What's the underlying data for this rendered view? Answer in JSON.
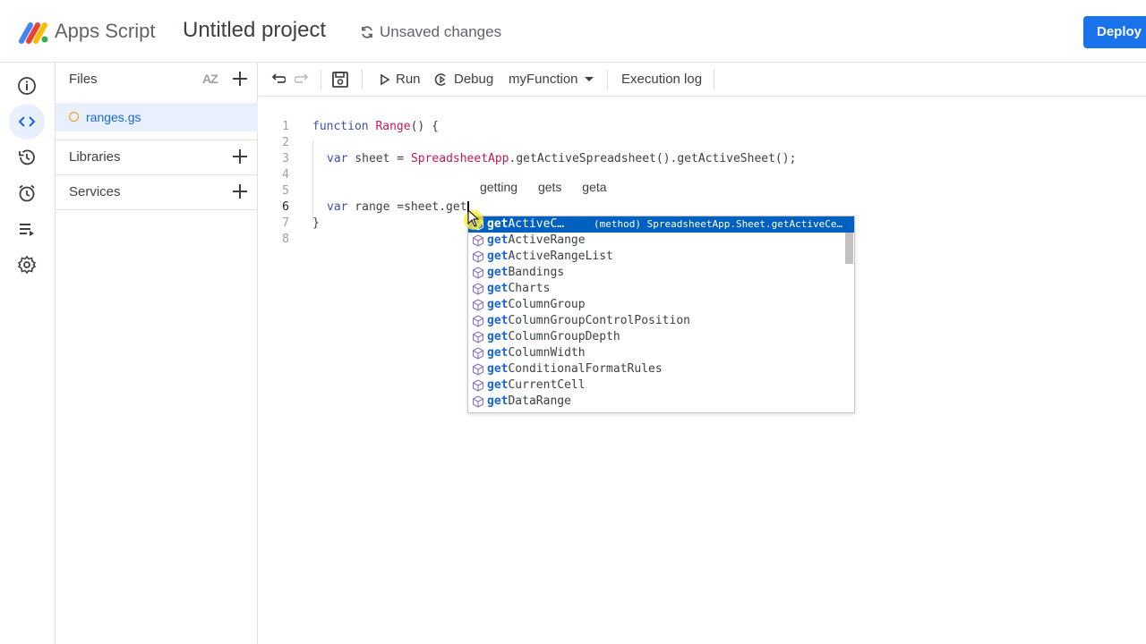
{
  "header": {
    "app_name": "Apps Script",
    "project_title": "Untitled project",
    "status": "Unsaved changes",
    "deploy_label": "Deploy"
  },
  "rail": {
    "items": [
      "overview-icon",
      "editor-icon",
      "executions-icon",
      "triggers-icon",
      "executions-list-icon",
      "settings-icon"
    ],
    "active": "editor-icon"
  },
  "files_panel": {
    "files_label": "Files",
    "sort_label": "AZ",
    "files": [
      "ranges.gs"
    ],
    "libraries_label": "Libraries",
    "services_label": "Services"
  },
  "toolbar": {
    "run_label": "Run",
    "debug_label": "Debug",
    "function_select": "myFunction",
    "execution_log_label": "Execution log"
  },
  "editor": {
    "line_numbers": [
      "1",
      "2",
      "3",
      "4",
      "5",
      "6",
      "7",
      "8"
    ],
    "line1_kw": "function",
    "line1_fn": "Range",
    "line1_rest": "() {",
    "line3_kw": "var",
    "line3_a": " sheet = ",
    "line3_fn": "SpreadsheetApp",
    "line3_b": ".getActiveSpreadsheet().getActiveSheet();",
    "line6_kw": "var",
    "line6_rest": " range =sheet.get",
    "line7": "}",
    "word_suggestions": [
      "getting",
      "gets",
      "geta"
    ]
  },
  "autocomplete": {
    "match_prefix": "get",
    "selected_detail": "(method) SpreadsheetApp.Sheet.getActiveCe…",
    "items": [
      {
        "rest": "ActiveC…"
      },
      {
        "rest": "ActiveRange"
      },
      {
        "rest": "ActiveRangeList"
      },
      {
        "rest": "Bandings"
      },
      {
        "rest": "Charts"
      },
      {
        "rest": "ColumnGroup"
      },
      {
        "rest": "ColumnGroupControlPosition"
      },
      {
        "rest": "ColumnGroupDepth"
      },
      {
        "rest": "ColumnWidth"
      },
      {
        "rest": "ConditionalFormatRules"
      },
      {
        "rest": "CurrentCell"
      },
      {
        "rest": "DataRange"
      }
    ]
  },
  "colors": {
    "accent": "#1a73e8",
    "selection": "#0060c0",
    "keyword": "#3f51b5",
    "function_name": "#c2185b"
  }
}
